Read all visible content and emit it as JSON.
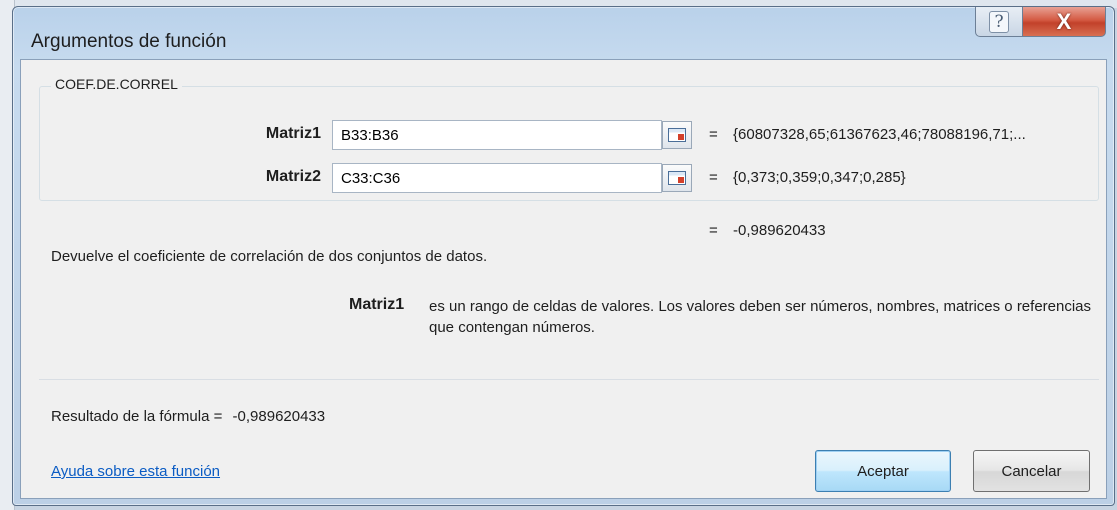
{
  "window": {
    "title": "Argumentos de función",
    "help_glyph": "?",
    "close_glyph": "X"
  },
  "function": {
    "name": "COEF.DE.CORREL"
  },
  "arguments": [
    {
      "label": "Matriz1",
      "value": "B33:B36",
      "preview": "{60807328,65;61367623,46;78088196,71;..."
    },
    {
      "label": "Matriz2",
      "value": "C33:C36",
      "preview": "{0,373;0,359;0,347;0,285}"
    }
  ],
  "equals_sign": "=",
  "function_result": "-0,989620433",
  "description": "Devuelve el coeficiente de correlación de dos conjuntos de datos.",
  "argument_help": {
    "name": "Matriz1",
    "text": "es un rango de celdas de valores. Los valores deben ser números, nombres, matrices o referencias que contengan números."
  },
  "formula_result": {
    "label": "Resultado de la fórmula =",
    "value": "-0,989620433"
  },
  "help_link": "Ayuda sobre esta función",
  "buttons": {
    "ok": "Aceptar",
    "cancel": "Cancelar"
  },
  "icons": {
    "collapse": "collapse-dialog-icon",
    "help": "help-icon",
    "close": "close-icon"
  }
}
